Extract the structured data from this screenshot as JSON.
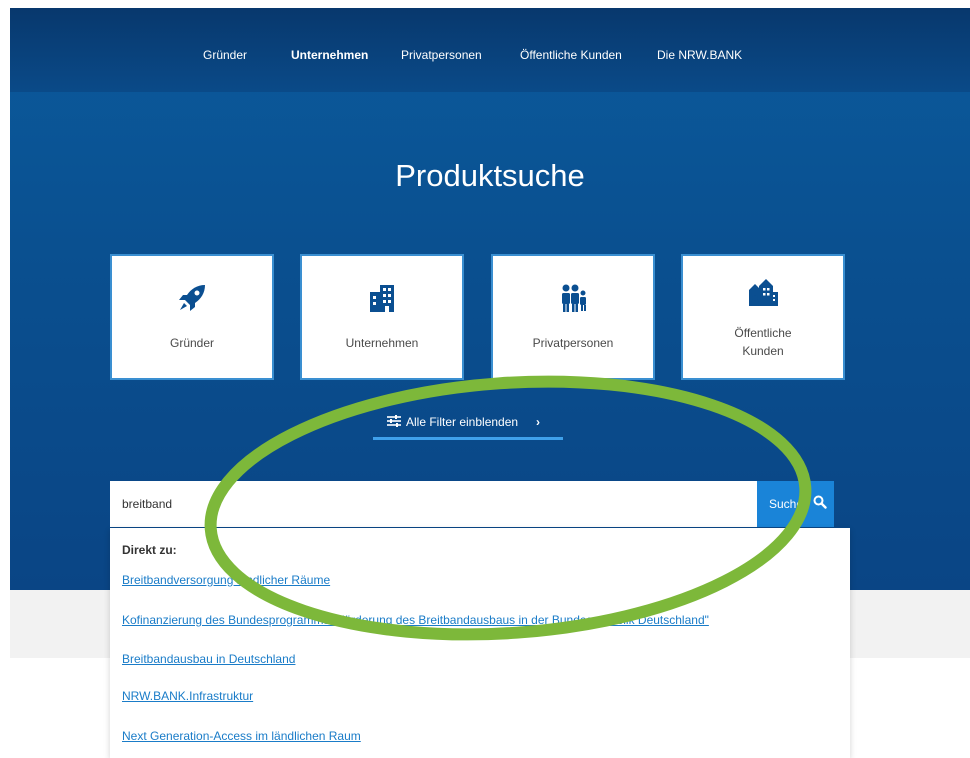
{
  "topnav": {
    "items": [
      {
        "label": "Gründer"
      },
      {
        "label": "Unternehmen"
      },
      {
        "label": "Privatpersonen"
      },
      {
        "label": "Öffentliche Kunden"
      },
      {
        "label": "Die NRW.BANK"
      }
    ],
    "active_index": 1
  },
  "hero": {
    "title": "Produktsuche"
  },
  "categories": [
    {
      "label": "Gründer",
      "icon": "rocket-icon"
    },
    {
      "label": "Unternehmen",
      "icon": "building-icon"
    },
    {
      "label": "Privatpersonen",
      "icon": "family-icon"
    },
    {
      "label_line1": "Öffentliche",
      "label_line2": "Kunden",
      "icon": "town-icon"
    }
  ],
  "filter": {
    "label": "Alle Filter einblenden",
    "chevron": "›"
  },
  "search": {
    "value": "breitband",
    "button_label": "Suche",
    "icon": "search-icon"
  },
  "suggestions": {
    "heading": "Direkt zu:",
    "items": [
      {
        "label": "Breitbandversorgung ländlicher Räume"
      },
      {
        "label": "Kofinanzierung des Bundesprogramms \"Förderung des Breitbandausbaus in der Bundesrepublik Deutschland\""
      },
      {
        "label": "Breitbandausbau in Deutschland"
      },
      {
        "label": "NRW.BANK.Infrastruktur"
      },
      {
        "label": "Next Generation-Access im ländlichen Raum"
      }
    ]
  },
  "colors": {
    "hero": "#0a4f8f",
    "accent": "#1a84d8",
    "link": "#1a7cc8",
    "highlight": "#7db83a"
  }
}
